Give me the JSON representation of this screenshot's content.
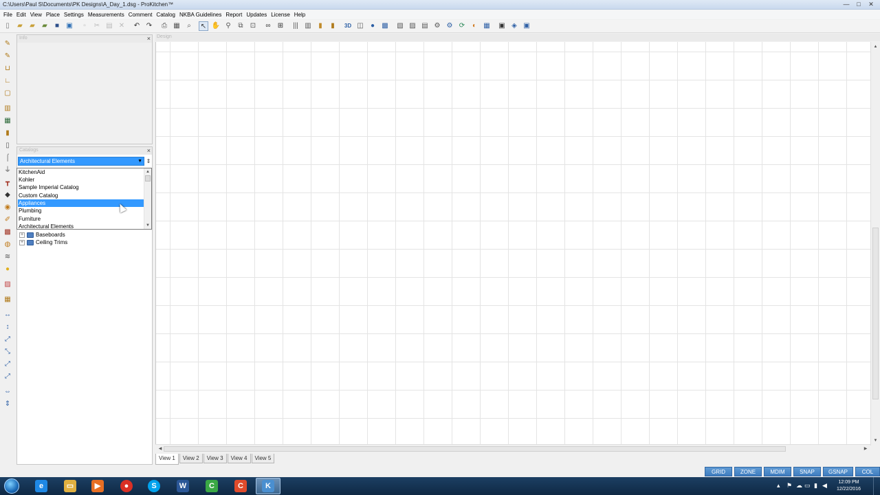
{
  "window": {
    "title": "C:\\Users\\Paul S\\Documents\\PK Designs\\A_Day_1.dsg - ProKitchen™",
    "minimize": "—",
    "maximize": "□",
    "close": "✕"
  },
  "menu": [
    "File",
    "Edit",
    "View",
    "Place",
    "Settings",
    "Measurements",
    "Comment",
    "Catalog",
    "NKBA Guidelines",
    "Report",
    "Updates",
    "License",
    "Help"
  ],
  "toolbar": {
    "items": [
      "new-icon",
      "open-icon",
      "open-folder-icon",
      "open-catalog-icon",
      "save-icon",
      "save-all-icon",
      "cut-icon",
      "copy-icon",
      "paste-icon",
      "delete-icon",
      "undo-icon",
      "redo-icon",
      "print-icon",
      "print-preview-icon",
      "find-icon",
      "select-pointer-icon",
      "pan-hand-icon",
      "zoom-window-icon",
      "zoom-extents-icon",
      "zoom-all-icon",
      "binoculars-icon",
      "layers-icon",
      "wall-icon",
      "cabinet-icon",
      "door-icon",
      "books-icon",
      "three-d-icon",
      "floorplan-icon",
      "sphere-icon",
      "camera-icon",
      "render-icon",
      "elevation-icon",
      "section-icon",
      "report-icon",
      "gear-icon",
      "refresh-icon",
      "palette-icon",
      "grid-icon",
      "export-icon",
      "link-icon",
      "help-icon"
    ],
    "three_d_label": "3D"
  },
  "left_tools": [
    "pencil-icon",
    "pen-icon",
    "u-wall-icon",
    "l-wall-icon",
    "room-icon",
    "cabinet-icon",
    "tall-cabinet-icon",
    "door-icon",
    "ladder-icon",
    "faucet-icon",
    "sink-icon",
    "table-icon",
    "lamp-icon",
    "chair-icon",
    "brush-icon",
    "window-icon",
    "tape-icon",
    "appliance-icon",
    "light-bulb-icon",
    "ruler-icon",
    "shelf-icon",
    "dimension-h-icon",
    "dimension-v-icon",
    "dimension-angle-icon",
    "measure-icon",
    "measure-diag-icon",
    "measure-run-icon",
    "move-h-icon",
    "move-v-icon"
  ],
  "info_panel": {
    "title": "Info",
    "close": "×"
  },
  "catalog_panel": {
    "title": "Catalogs",
    "close": "×",
    "selected": "Architectural Elements",
    "pin": "⇕",
    "options": [
      "KitchenAid",
      "Kohler",
      "Sample Imperial Catalog",
      "Custom Catalog",
      "Appliances",
      "Plumbing",
      "Furniture",
      "Architectural Elements"
    ],
    "highlighted_option": "Appliances",
    "tree": [
      {
        "label": "Baseboards",
        "expander": "+"
      },
      {
        "label": "Ceiling Trims",
        "expander": "+"
      }
    ]
  },
  "design": {
    "title": "Design",
    "tabs": [
      "View 1",
      "View 2",
      "View 3",
      "View 4",
      "View 5"
    ],
    "active_tab": "View 1"
  },
  "status_buttons": [
    "GRID",
    "ZONE",
    "MDIM",
    "SNAP",
    "GSNAP",
    "COL"
  ],
  "taskbar": {
    "apps": [
      {
        "name": "internet-explorer-icon",
        "glyph": "e",
        "color": "#1e88e5"
      },
      {
        "name": "file-explorer-icon",
        "glyph": "▭",
        "color": "#e0b040"
      },
      {
        "name": "media-player-icon",
        "glyph": "▶",
        "color": "#e76f24"
      },
      {
        "name": "chrome-icon",
        "glyph": "●",
        "color": "#d93025"
      },
      {
        "name": "skype-icon",
        "glyph": "S",
        "color": "#00a2ed"
      },
      {
        "name": "word-icon",
        "glyph": "W",
        "color": "#2b5797"
      },
      {
        "name": "camtasia-green-icon",
        "glyph": "C",
        "color": "#3aa845"
      },
      {
        "name": "camtasia-red-icon",
        "glyph": "C",
        "color": "#e04b2c"
      },
      {
        "name": "prokitchen-icon",
        "glyph": "K",
        "color": "#4a8fd0"
      }
    ],
    "active_app": "prokitchen-icon",
    "time": "12:09 PM",
    "date": "12/22/2016"
  }
}
